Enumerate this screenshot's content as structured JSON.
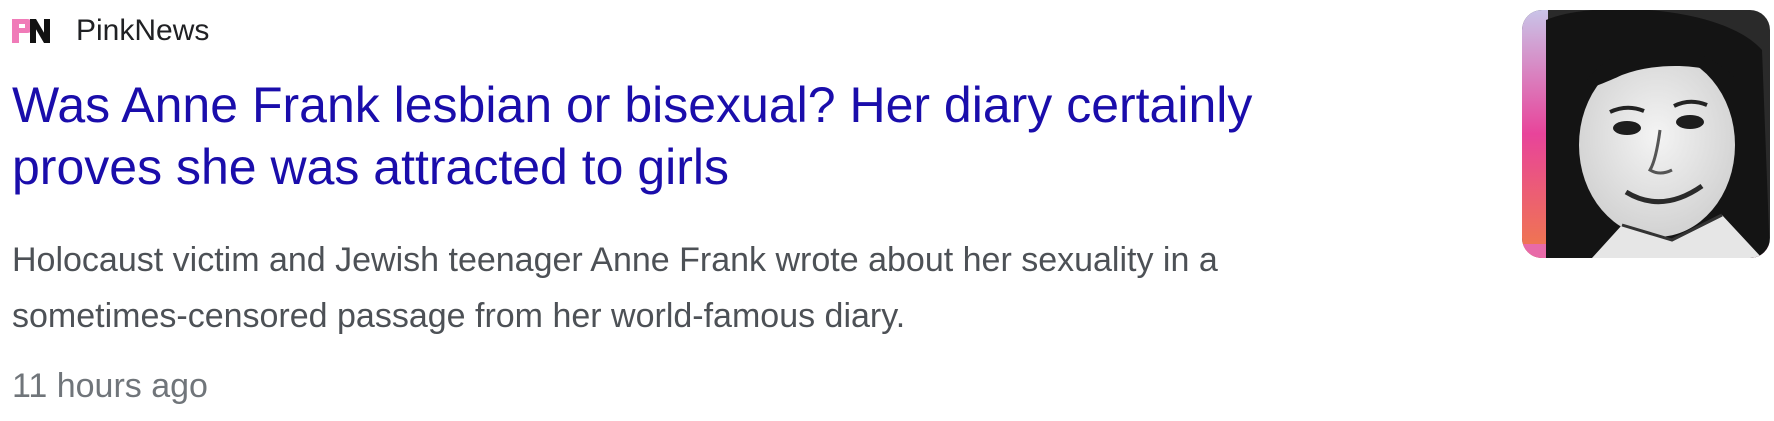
{
  "result": {
    "source_name": "PinkNews",
    "source_logo_icon": "pinknews-logo-icon",
    "headline": "Was Anne Frank lesbian or bisexual? Her diary certainly proves she was attracted to girls",
    "snippet": "Holocaust victim and Jewish teenager Anne Frank wrote about her sexuality in a sometimes-censored passage from her world-famous diary.",
    "timestamp": "11 hours ago",
    "thumbnail_icon": "portrait-photo-thumbnail"
  },
  "colors": {
    "link": "#1a0dab",
    "snippet": "#4d5156",
    "timestamp": "#70757a",
    "brand_pink": "#e8449a"
  }
}
